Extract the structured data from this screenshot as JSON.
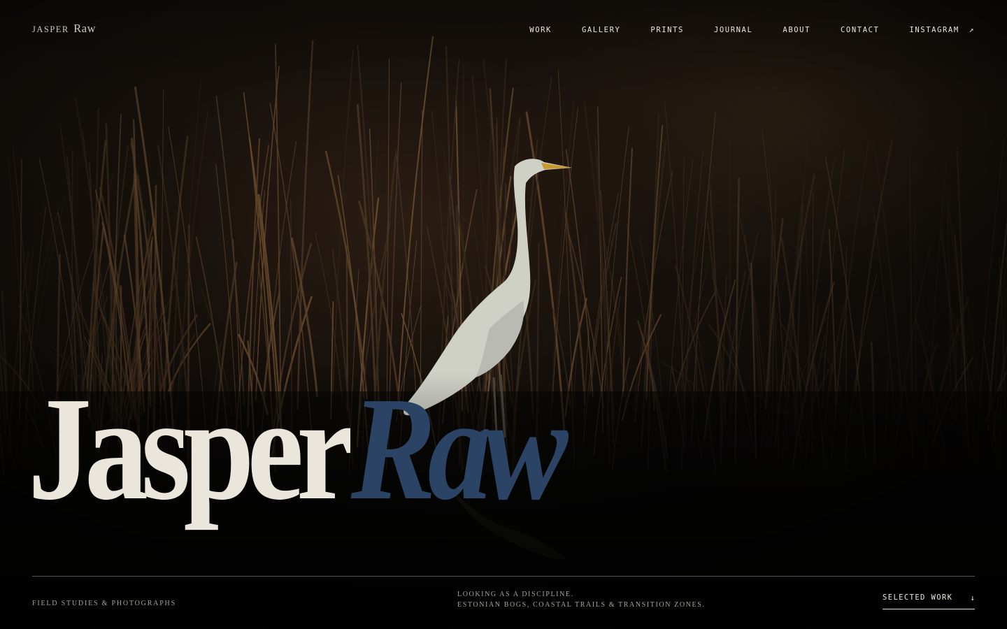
{
  "brand": {
    "first": "Jasper",
    "last": "Raw"
  },
  "nav": {
    "items": [
      {
        "label": "WORK"
      },
      {
        "label": "GALLERY"
      },
      {
        "label": "PRINTS"
      },
      {
        "label": "JOURNAL"
      },
      {
        "label": "ABOUT"
      },
      {
        "label": "CONTACT"
      },
      {
        "label": "INSTAGRAM"
      }
    ],
    "external_arrow": "↗"
  },
  "hero": {
    "first": "Jasper",
    "last": "Raw"
  },
  "footer": {
    "tagline": "FIELD STUDIES & PHOTOGRAPHS",
    "statement_line1": "LOOKING AS A DISCIPLINE.",
    "statement_line2": "ESTONIAN BOGS, COASTAL TRAILS & TRANSITION ZONES.",
    "cta_label": "SELECTED WORK",
    "cta_arrow": "↓"
  },
  "colors": {
    "background": "#0c0a08",
    "ivory": "#ebe6dc",
    "accent_blue": "#2b4466",
    "muted_text": "#a9a397"
  }
}
